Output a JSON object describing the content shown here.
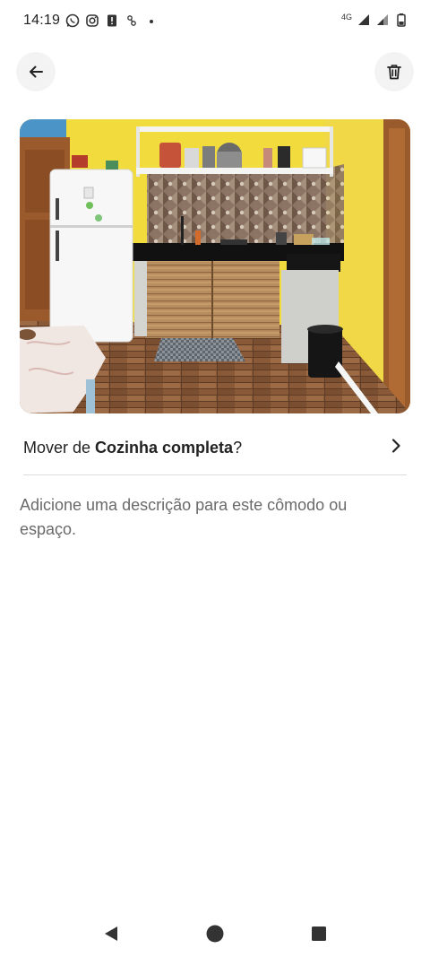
{
  "status_bar": {
    "time": "14:19",
    "network": "4G",
    "icons": [
      "whatsapp-icon",
      "instagram-icon",
      "alert-icon",
      "usb-icon",
      "dot-icon",
      "signal-icon",
      "signal-icon",
      "battery-icon"
    ]
  },
  "header": {
    "back_icon": "arrow-left-icon",
    "delete_icon": "trash-icon"
  },
  "photo": {
    "subject": "kitchen"
  },
  "move_row": {
    "prefix": "Mover de ",
    "room": "Cozinha completa",
    "suffix": "?",
    "chevron_icon": "chevron-right-icon"
  },
  "description": {
    "placeholder": "Adicione uma descrição para este cômodo ou espaço."
  },
  "nav_bar": {
    "back_icon": "nav-back-triangle-icon",
    "home_icon": "nav-home-circle-icon",
    "recent_icon": "nav-recent-square-icon"
  },
  "colors": {
    "text": "#222222",
    "muted": "#6a6a6a",
    "divider": "#dddddd",
    "button_bg": "#f3f3f3"
  }
}
